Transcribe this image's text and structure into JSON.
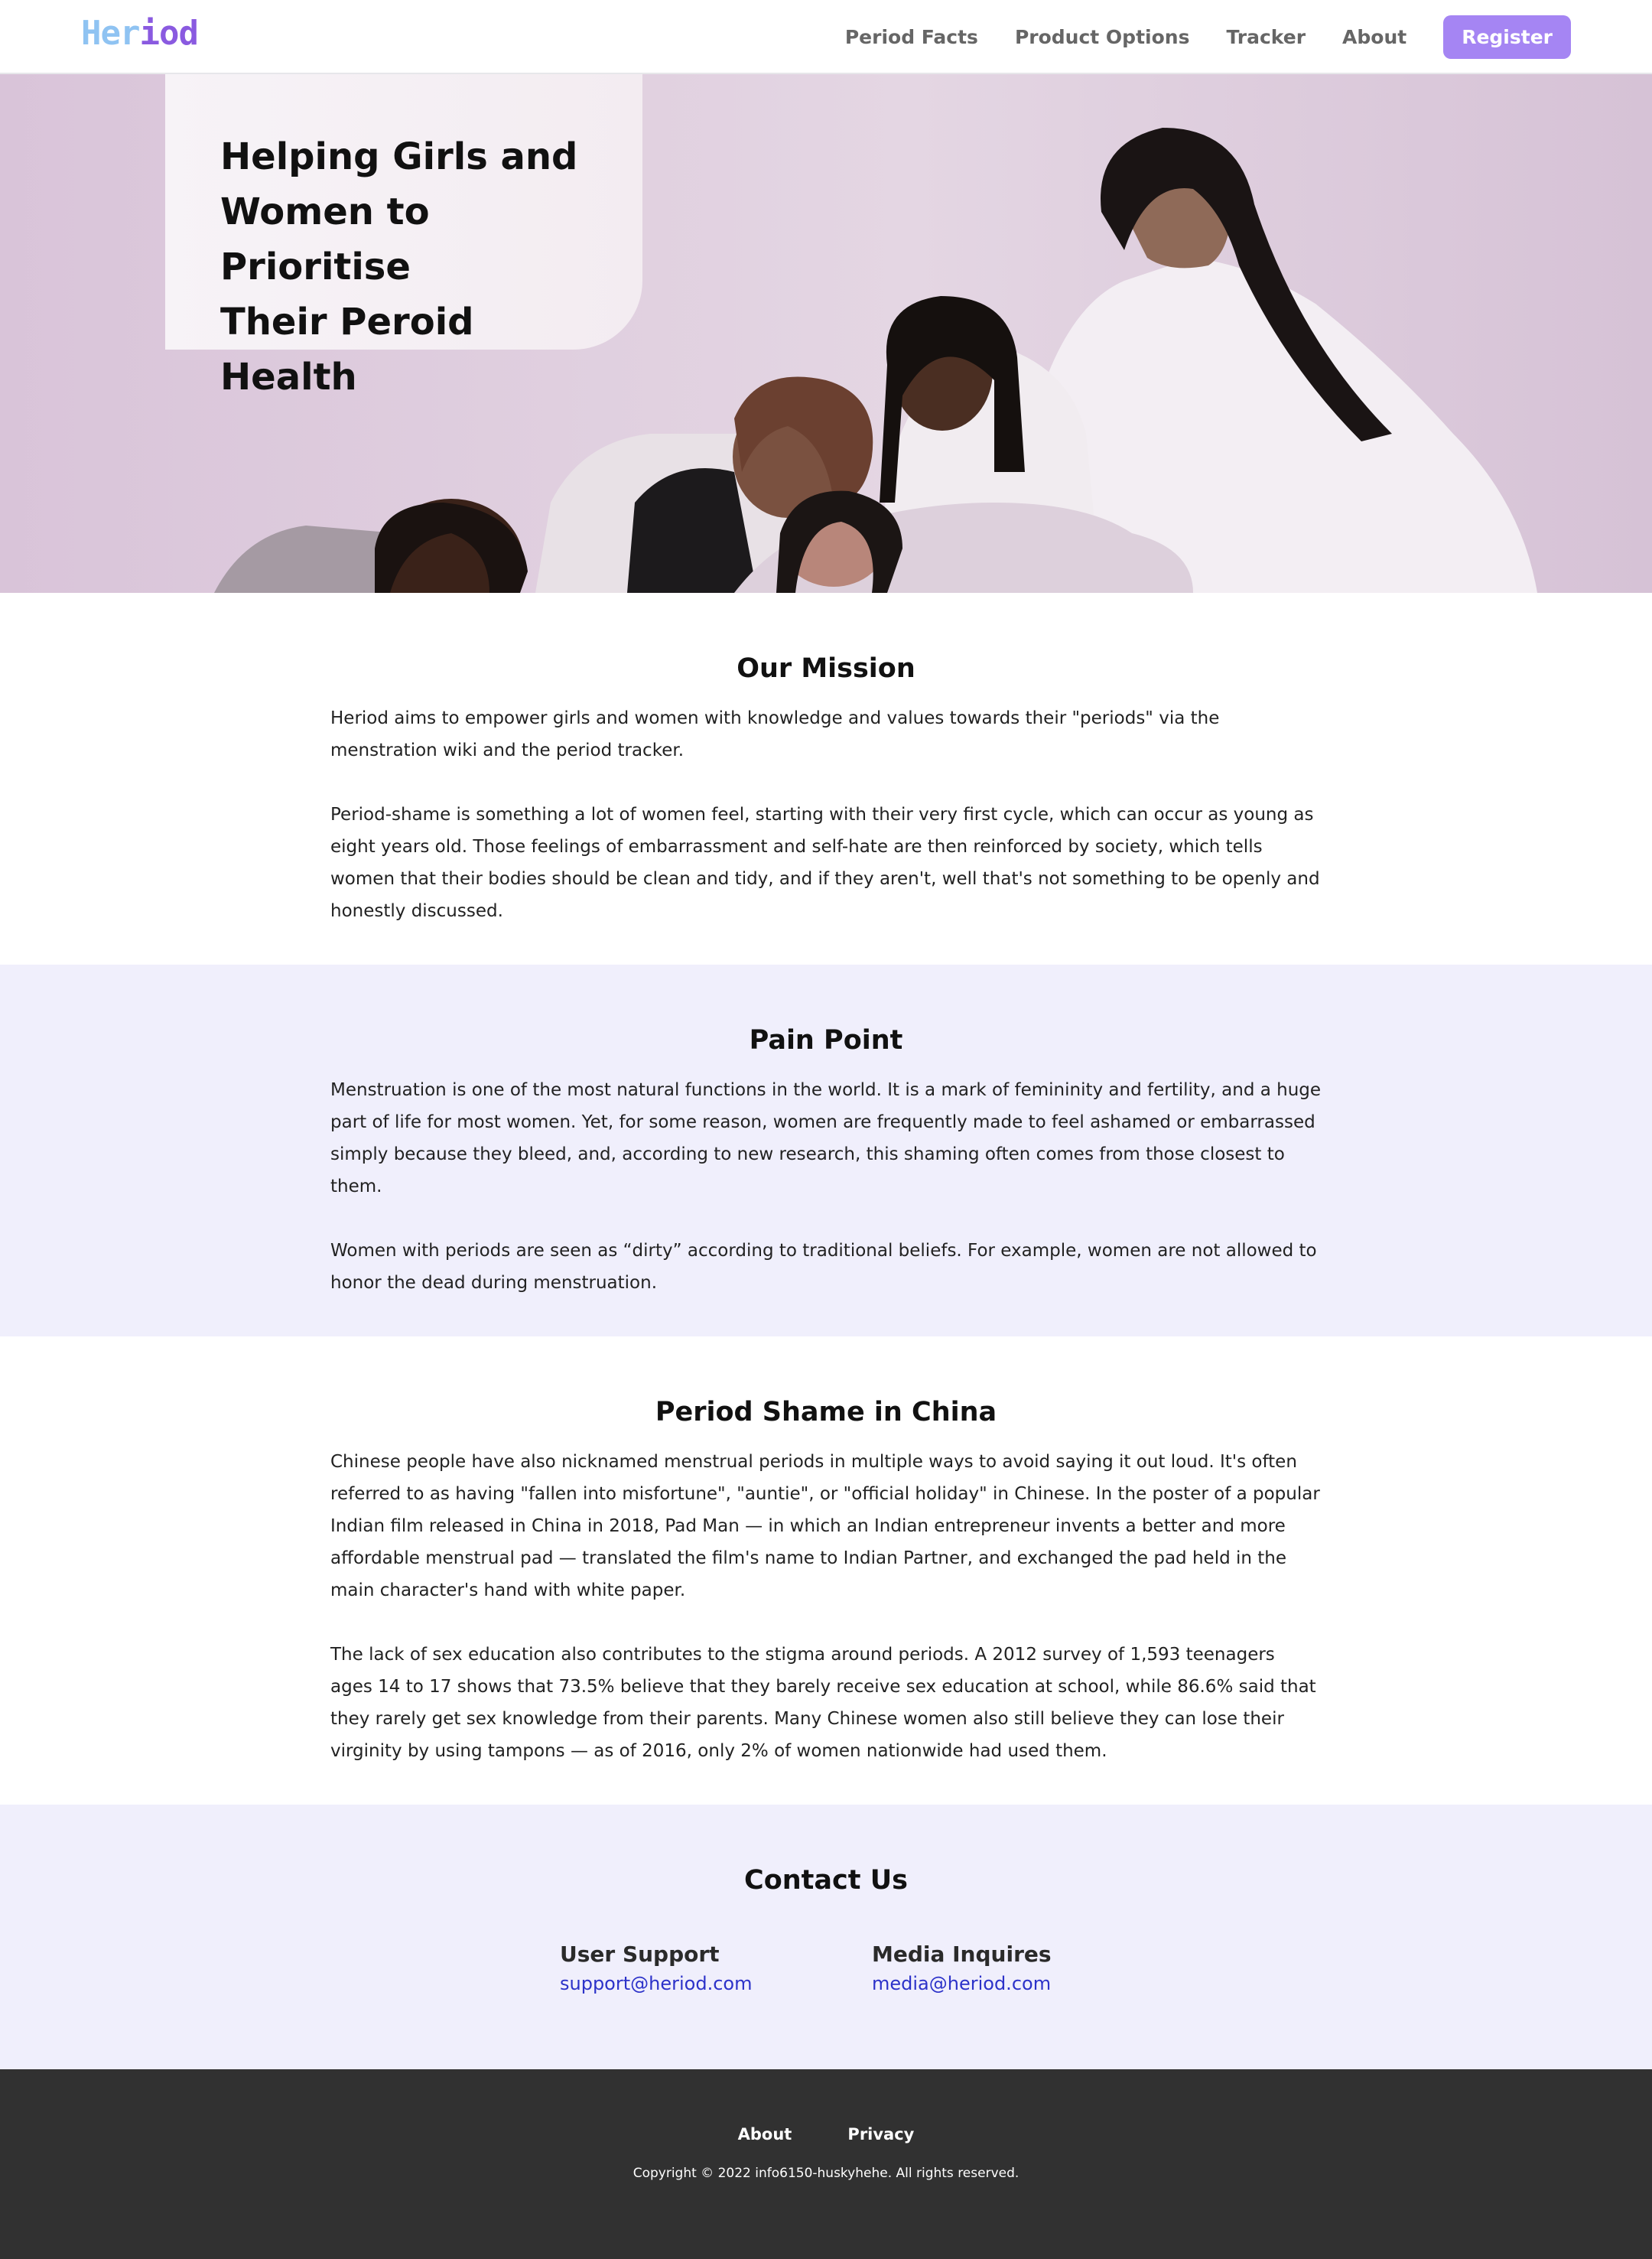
{
  "brand": {
    "logo_part1": "Her",
    "logo_part2": "iod"
  },
  "nav": {
    "links": [
      "Period Facts",
      "Product Options",
      "Tracker",
      "About"
    ],
    "register_label": "Register"
  },
  "hero": {
    "title_line1": "Helping Girls and",
    "title_line2": "Women to Prioritise",
    "title_line3": "Their Peroid Health",
    "image_icon": "group-of-women-photo"
  },
  "mission": {
    "title": "Our Mission",
    "paragraphs": [
      "Heriod aims to empower girls and women with knowledge and values towards their \"periods\" via the menstration wiki and the period tracker.",
      "Period-shame is something a lot of women feel, starting with their very first cycle, which can occur as young as eight years old. Those feelings of embarrassment and self-hate are then reinforced by society, which tells women that their bodies should be clean and tidy, and if they aren't, well that's not something to be openly and honestly discussed."
    ]
  },
  "pain_point": {
    "title": "Pain Point",
    "paragraphs": [
      "Menstruation is one of the most natural functions in the world. It is a mark of femininity and fertility, and a huge part of life for most women. Yet, for some reason, women are frequently made to feel ashamed or embarrassed simply because they bleed, and, according to new research, this shaming often comes from those closest to them.",
      "Women with periods are seen as “dirty” according to traditional beliefs. For example, women are not allowed to honor the dead during menstruation."
    ]
  },
  "china": {
    "title": "Period Shame in China",
    "paragraphs": [
      "Chinese people have also nicknamed menstrual periods in multiple ways to avoid saying it out loud. It's often referred to as having \"fallen into misfortune\", \"auntie\", or \"official holiday\" in Chinese. In the poster of a popular Indian film released in China in 2018, Pad Man — in which an Indian entrepreneur invents a better and more affordable menstrual pad — translated the film's name to Indian Partner, and exchanged the pad held in the main character's hand with white paper.",
      "The lack of sex education also contributes to the stigma around periods. A 2012 survey of 1,593 teenagers ages 14 to 17 shows that 73.5% believe that they barely receive sex education at school, while 86.6% said that they rarely get sex knowledge from their parents. Many Chinese women also still believe they can lose their virginity by using tampons — as of 2016, only 2% of women nationwide had used them."
    ]
  },
  "contact": {
    "title": "Contact Us",
    "columns": [
      {
        "heading": "User Support",
        "email": "support@heriod.com"
      },
      {
        "heading": "Media Inquires",
        "email": "media@heriod.com"
      }
    ]
  },
  "footer": {
    "links": [
      "About",
      "Privacy"
    ],
    "copyright": "Copyright © 2022 info6150-huskyhehe. All rights reserved."
  },
  "colors": {
    "accent": "#a585f3",
    "logo_light": "#8fc3f2",
    "logo_dark": "#8a5ae0",
    "section_tint": "#f0effc",
    "footer_bg": "#313131",
    "link": "#2c32c9"
  }
}
